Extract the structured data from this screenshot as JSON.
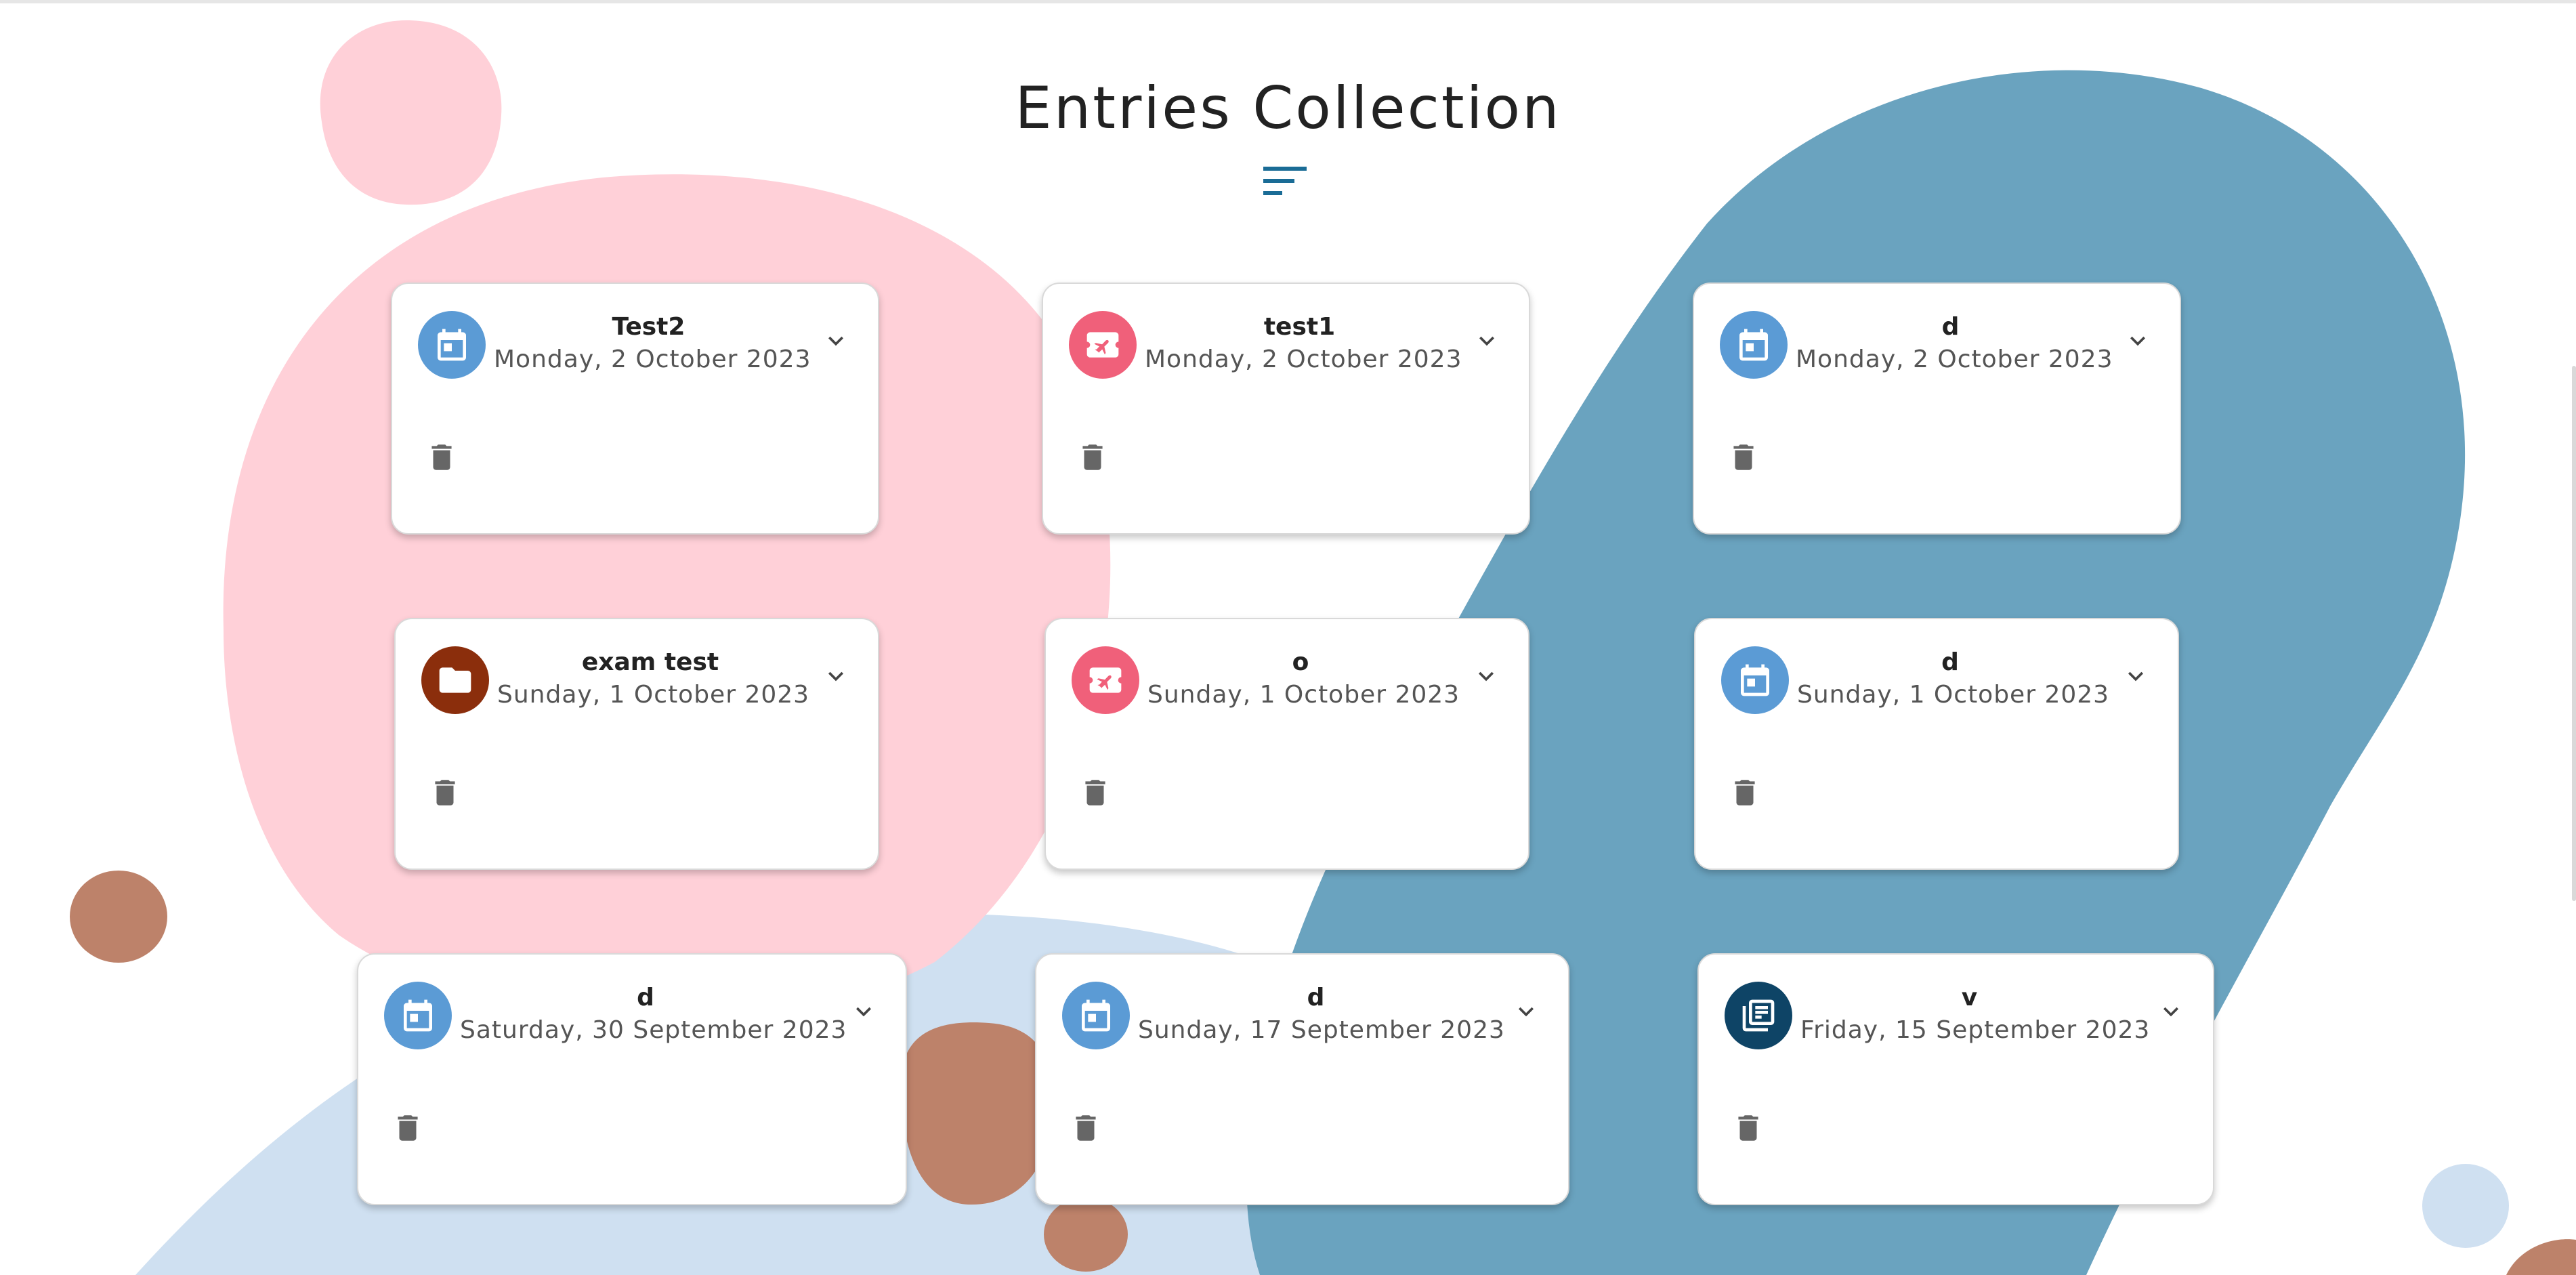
{
  "page": {
    "title": "Entries Collection"
  },
  "colors": {
    "pink_blob": "#ffd0d8",
    "teal_blob": "#6aa3bf",
    "lightblue_blob": "#cfe0f1",
    "brown_blob": "#bd826a",
    "calendar_avatar": "#5b9bd5",
    "travel_avatar": "#f0607a",
    "folder_avatar": "#8b2e0c",
    "news_avatar": "#0e4466",
    "filter_icon": "#1a6c96"
  },
  "entries": [
    {
      "title": "Test2",
      "date": "Monday, 2 October 2023",
      "icon": "calendar-icon"
    },
    {
      "title": "test1",
      "date": "Monday, 2 October 2023",
      "icon": "flight-ticket-icon"
    },
    {
      "title": "d",
      "date": "Monday, 2 October 2023",
      "icon": "calendar-icon"
    },
    {
      "title": "exam test",
      "date": "Sunday, 1 October 2023",
      "icon": "folder-icon"
    },
    {
      "title": "o",
      "date": "Sunday, 1 October 2023",
      "icon": "flight-ticket-icon"
    },
    {
      "title": "d",
      "date": "Sunday, 1 October 2023",
      "icon": "calendar-icon"
    },
    {
      "title": "d",
      "date": "Saturday, 30 September 2023",
      "icon": "calendar-icon"
    },
    {
      "title": "d",
      "date": "Sunday, 17 September 2023",
      "icon": "calendar-icon"
    },
    {
      "title": "v",
      "date": "Friday, 15 September 2023",
      "icon": "newspaper-icon"
    }
  ]
}
